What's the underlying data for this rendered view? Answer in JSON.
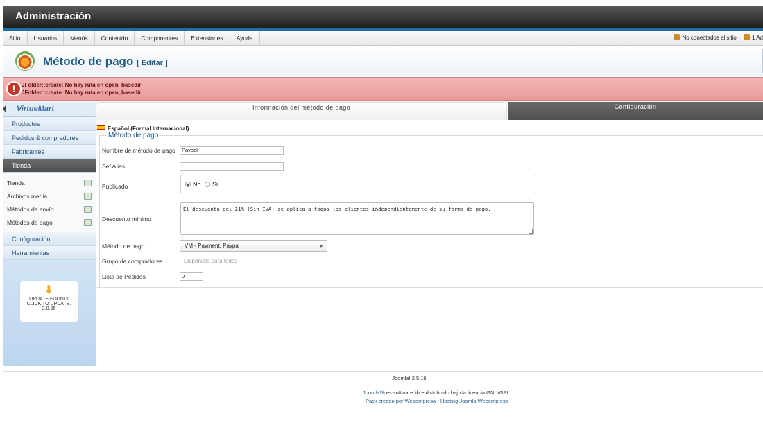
{
  "app": {
    "title": "Administración"
  },
  "menu": {
    "items": [
      "Sitio",
      "Usuarios",
      "Menús",
      "Contenido",
      "Componentes",
      "Extensiones",
      "Ayuda"
    ],
    "right": {
      "not_connected": "No conectados al sitio",
      "admins": "1 Ad"
    }
  },
  "page": {
    "title": "Método de pago",
    "edit": "[ Editar ]"
  },
  "errors": [
    "JFolder::create: No hay ruta en open_basedir",
    "JFolder::create: No hay ruta en open_basedir"
  ],
  "sidebar": {
    "logo": "VirtueMart",
    "categories": [
      {
        "label": "Productos",
        "active": false
      },
      {
        "label": "Pedidos & compradores",
        "active": false
      },
      {
        "label": "Fabricantes",
        "active": false
      },
      {
        "label": "Tienda",
        "active": true
      }
    ],
    "sub_items": [
      "Tienda",
      "Archivos media",
      "Métodos de envío",
      "Métodos de pago"
    ],
    "bottom_categories": [
      "Configuración",
      "Herramientas"
    ],
    "update": {
      "line1": "UPDATE FOUND!",
      "line2": "CLICK TO UPDATE.",
      "version": "2.0.26"
    }
  },
  "tabs": {
    "info": "Información del método de pago",
    "config": "Configuración"
  },
  "form": {
    "language": "Español (Formal Internacional)",
    "legend": "Método de pago",
    "name_label": "Nombre de método de pago",
    "name_value": "Paypal",
    "alias_label": "Sef Alias",
    "alias_value": "",
    "published_label": "Publicado",
    "published_no": "No",
    "published_yes": "Si",
    "published_selected": "No",
    "discount_label": "Descuento mínimo",
    "discount_text": "El descuento del 21% (Sin IVA) se aplica a todos los clientes independientemente de su forma de pago.",
    "method_label": "Método de pago",
    "method_value": "VM - Payment, Paypal",
    "group_label": "Grupo de compradores",
    "group_placeholder": "Disponible para todos",
    "order_label": "Lista de Pedidos",
    "order_value": "0"
  },
  "footer": {
    "version": "Joomla! 2.5.16",
    "joomla_link": "Joomla!®",
    "license_text": "es software libre distribuido bajo la licencia GNU/GPL.",
    "pack_text": "Pack creado por",
    "webempresa": "Webempresa",
    "separator": "-",
    "hosting": "Hosting Joomla Webempresa"
  }
}
